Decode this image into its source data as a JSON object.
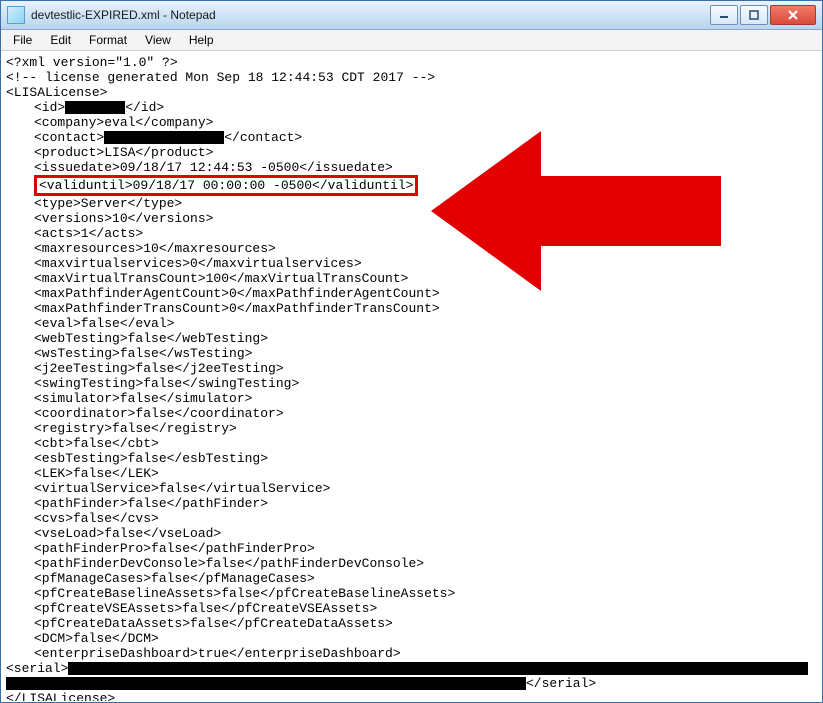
{
  "window": {
    "title": "devtestlic-EXPIRED.xml - Notepad"
  },
  "menu": {
    "file": "File",
    "edit": "Edit",
    "format": "Format",
    "view": "View",
    "help": "Help"
  },
  "doc": {
    "xml_decl": "<?xml version=\"1.0\" ?>",
    "blank": "",
    "comment": "<!-- license generated Mon Sep 18 12:44:53 CDT 2017 -->",
    "root_open": "<LISALicense>",
    "id_open": "<id>",
    "id_close": "</id>",
    "company": "<company>eval</company>",
    "contact_open": "<contact>",
    "contact_close": "</contact>",
    "product": "<product>LISA</product>",
    "issuedate": "<issuedate>09/18/17 12:44:53 -0500</issuedate>",
    "validuntil": "<validuntil>09/18/17 00:00:00 -0500</validuntil>",
    "type": "<type>Server</type>",
    "versions": "<versions>10</versions>",
    "acts": "<acts>1</acts>",
    "maxresources": "<maxresources>10</maxresources>",
    "maxvirtualservices": "<maxvirtualservices>0</maxvirtualservices>",
    "maxVirtualTransCount": "<maxVirtualTransCount>100</maxVirtualTransCount>",
    "maxPathfinderAgentCount": "<maxPathfinderAgentCount>0</maxPathfinderAgentCount>",
    "maxPathfinderTransCount": "<maxPathfinderTransCount>0</maxPathfinderTransCount>",
    "eval": "<eval>false</eval>",
    "webTesting": "<webTesting>false</webTesting>",
    "wsTesting": "<wsTesting>false</wsTesting>",
    "j2eeTesting": "<j2eeTesting>false</j2eeTesting>",
    "swingTesting": "<swingTesting>false</swingTesting>",
    "simulator": "<simulator>false</simulator>",
    "coordinator": "<coordinator>false</coordinator>",
    "registry": "<registry>false</registry>",
    "cbt": "<cbt>false</cbt>",
    "esbTesting": "<esbTesting>false</esbTesting>",
    "LEK": "<LEK>false</LEK>",
    "virtualService": "<virtualService>false</virtualService>",
    "pathFinder": "<pathFinder>false</pathFinder>",
    "cvs": "<cvs>false</cvs>",
    "vseLoad": "<vseLoad>false</vseLoad>",
    "pathFinderPro": "<pathFinderPro>false</pathFinderPro>",
    "pathFinderDevConsole": "<pathFinderDevConsole>false</pathFinderDevConsole>",
    "pfManageCases": "<pfManageCases>false</pfManageCases>",
    "pfCreateBaselineAssets": "<pfCreateBaselineAssets>false</pfCreateBaselineAssets>",
    "pfCreateVSEAssets": "<pfCreateVSEAssets>false</pfCreateVSEAssets>",
    "pfCreateDataAssets": "<pfCreateDataAssets>false</pfCreateDataAssets>",
    "DCM": "<DCM>false</DCM>",
    "enterpriseDashboard": "<enterpriseDashboard>true</enterpriseDashboard>",
    "serial_open": "<serial>",
    "serial_close": "</serial>",
    "root_close": "</LISALicense>"
  }
}
